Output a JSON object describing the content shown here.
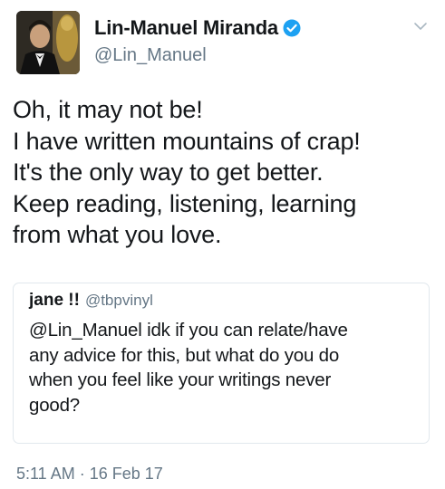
{
  "author": {
    "display_name": "Lin-Manuel Miranda",
    "handle": "@Lin_Manuel",
    "verified": true,
    "avatar": "avatar-photo"
  },
  "tweet": {
    "text": "Oh, it may not be!\nI have written mountains of crap!\nIt's the only way to get better.\nKeep reading, listening, learning\nfrom what you love.",
    "timestamp": "5:11 AM · 16 Feb 17"
  },
  "quoted_tweet": {
    "display_name": "jane !!",
    "handle": "@tbpvinyl",
    "text": "@Lin_Manuel idk if you can relate/have\nany advice for this, but what do you do\nwhen you feel like your writings never\ngood?"
  },
  "icons": {
    "verified": "verified-badge-icon",
    "menu": "chevron-down-icon"
  },
  "colors": {
    "verified_blue": "#1da1f2",
    "secondary_text": "#657786",
    "border": "#e1e8ed"
  }
}
